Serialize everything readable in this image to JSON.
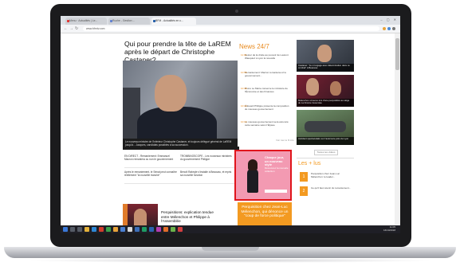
{
  "browser": {
    "tabs": [
      {
        "label": "Menu · Actualités | Le..."
      },
      {
        "label": "Ruche - Gestion ..."
      },
      {
        "label": "BFM - Actualités en c..."
      }
    ],
    "url": "www.bfmtv.com",
    "window_controls": "– ▢ ✕"
  },
  "article": {
    "headline": "Qui pour prendre la tête de LaREM après le départ de Christophe Castaner?",
    "hero_caption": "Le nouveau ministre de l'Intérieur Christophe Castaner, et toujours délégué général de LaREM jusqu'à... Jacques, candidats possibles à sa succession.",
    "stories": [
      "EN DIRECT - Remaniement: Emmanuel Macron remaniera ou non le gouvernement",
      "TROMBINOSCOPE - Les nouveaux ministres du gouvernement Philippe",
      "Après le remaniement, le Sénat peut connaître réellement \"la nouvelle tranche\"",
      "Benoît Rabeyle s'installe à Beauvau, et repris sa nouvelle fonction"
    ],
    "side_title": "Perquisitions: explication tendue entre Mélenchon et Philippe à l'Assemblée"
  },
  "news247": {
    "header": "News 24/7",
    "items": [
      {
        "time": "11:02",
        "text": "Retour de la droite au pouvoir de Laurent Wauquiez à Lyon la nouvelle"
      },
      {
        "time": "10:55",
        "text": "Remaniement: Macron remaniera-t-il le gouvernement..."
      },
      {
        "time": "10:48",
        "text": "Bruno Le Maire conserve le ministère de l'Économie et des Finances"
      },
      {
        "time": "10:40",
        "text": "Édouard Philippe présente la composition du nouveau gouvernement"
      },
      {
        "time": "10:32",
        "text": "Le nouveau gouvernement sera annoncé cette semaine selon l'Élysée"
      }
    ],
    "more_link": "Voir tout le fil info"
  },
  "ad": {
    "title": "Chaque jour, un nouveau style",
    "text": "Découvrez la nouvelle collection",
    "border_color": "#e0151c",
    "background_color": "#f39ab2"
  },
  "promo": {
    "text": "Perquisition chez Jean-Luc Mélenchon, qui dénonce un \"coup de force politique\""
  },
  "right_column": {
    "thumbs": [
      {
        "caption": "Castaner: \"Je m'engage avec détermination dans ce combat\" à Beauvau"
      },
      {
        "caption": "Mélenchon s'énerve lors d'une perquisition au siège de La France insoumise"
      },
      {
        "caption": "Accident spectaculaire sur l'autoroute près de Lyon"
      }
    ],
    "more_button": "Toutes les vidéos"
  },
  "plus_lus": {
    "header": "Les + lus",
    "items": [
      {
        "rank": "1",
        "text": "Perquisition chez Jean-Luc Mélenchon: le leader..."
      },
      {
        "rank": "2",
        "text": "Ce qu'il faut retenir du remaniement..."
      }
    ]
  },
  "taskbar": {
    "time": "11:05",
    "date": "16/10/2018"
  },
  "colors": {
    "accent": "#f39a21",
    "ad_highlight": "#e0151c",
    "browser_chrome": "#dee1e6",
    "taskbar": "#1f1f26"
  }
}
